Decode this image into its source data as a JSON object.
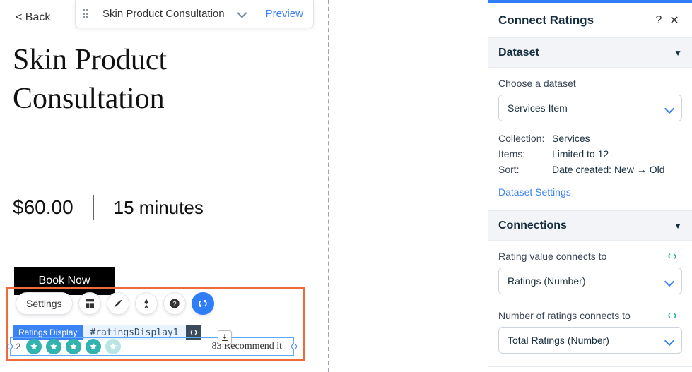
{
  "topbar": {
    "back_label": "< Back",
    "page_name": "Skin Product Consultation",
    "preview_label": "Preview"
  },
  "page": {
    "title": "Skin Product Consultation",
    "price": "$60.00",
    "duration": "15 minutes",
    "book_label": "Book Now"
  },
  "selection": {
    "settings_label": "Settings",
    "element_label": "Ratings Display",
    "element_id": "#ratingsDisplay1"
  },
  "ratings": {
    "value_short": ".2",
    "count": 83,
    "text_suffix": "Recommend it",
    "full_text": "83 Recommend it"
  },
  "panel": {
    "title": "Connect Ratings",
    "help": "?",
    "close": "✕",
    "sections": {
      "dataset": {
        "title": "Dataset",
        "choose_label": "Choose a dataset",
        "selected": "Services Item",
        "collection_label": "Collection:",
        "collection_value": "Services",
        "items_label": "Items:",
        "items_value": "Limited to 12",
        "sort_label": "Sort:",
        "sort_value": "Date created: New → Old",
        "settings_link": "Dataset Settings"
      },
      "connections": {
        "title": "Connections",
        "rating_value_label": "Rating value connects to",
        "rating_value_selected": "Ratings (Number)",
        "num_ratings_label": "Number of ratings connects to",
        "num_ratings_selected": "Total Ratings (Number)"
      }
    }
  }
}
